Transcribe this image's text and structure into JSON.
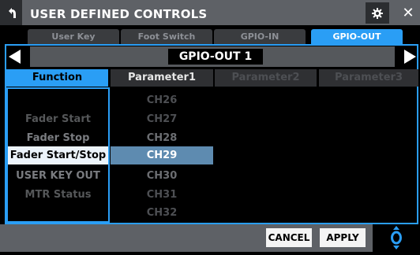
{
  "header": {
    "title": "USER DEFINED CONTROLS"
  },
  "tabs": [
    {
      "label": "User Key"
    },
    {
      "label": "Foot Switch"
    },
    {
      "label": "GPIO-IN"
    },
    {
      "label": "GPIO-OUT",
      "active": true
    }
  ],
  "selector": {
    "value": "GPIO-OUT 1"
  },
  "columns": {
    "function": "Function",
    "parameter1": "Parameter1",
    "parameter2": "Parameter2",
    "parameter3": "Parameter3"
  },
  "functions": {
    "items": [
      "",
      "Fader Start",
      "Fader Stop",
      "Fader Start/Stop",
      "USER KEY OUT",
      "MTR Status"
    ],
    "selected": "Fader Start/Stop"
  },
  "parameter1": {
    "items": [
      "CH26",
      "CH27",
      "CH28",
      "CH29",
      "CH30",
      "CH31",
      "CH32"
    ],
    "selected": "CH29"
  },
  "footer": {
    "cancel_label": "CANCEL",
    "apply_label": "APPLY"
  },
  "colors": {
    "accent": "#2a9ef5",
    "selection": "#5e8bb0",
    "bar": "#5e6166"
  },
  "icons": {
    "back": "back-arrow-icon",
    "settings": "gear-icon",
    "close": "close-icon",
    "prev": "triangle-left-icon",
    "next": "triangle-right-icon",
    "knob": "knob-icon"
  }
}
